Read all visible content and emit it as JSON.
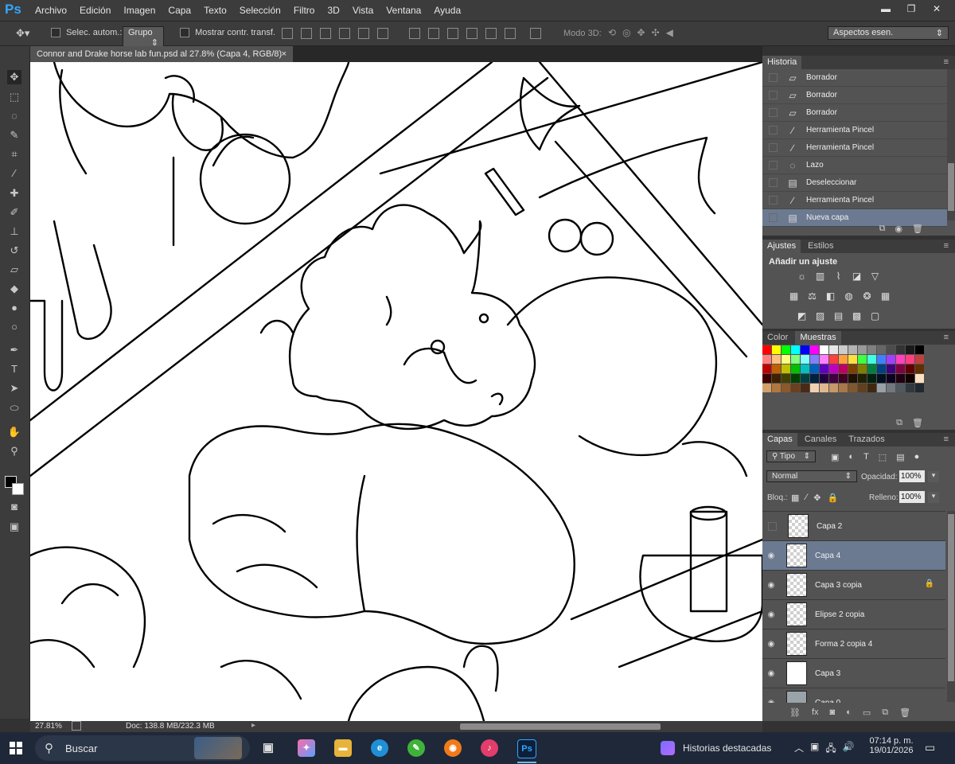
{
  "app": {
    "logo": "Ps"
  },
  "menu": [
    "Archivo",
    "Edición",
    "Imagen",
    "Capa",
    "Texto",
    "Selección",
    "Filtro",
    "3D",
    "Vista",
    "Ventana",
    "Ayuda"
  ],
  "window_controls": {
    "minimize": "▬",
    "restore": "❐",
    "close": "✕"
  },
  "options_bar": {
    "auto_select_label": "Selec. autom.:",
    "auto_select_value": "Grupo",
    "transform_label": "Mostrar contr. transf.",
    "mode3d_label": "Modo 3D:",
    "workspace": "Aspectos esen."
  },
  "document": {
    "tab_title": "Connor and Drake horse lab fun.psd al 27.8% (Capa 4, RGB/8)",
    "tab_close": "×"
  },
  "status": {
    "zoom": "27.81%",
    "doc_info": "Doc: 138.8 MB/232.3 MB"
  },
  "history": {
    "title": "Historia",
    "items": [
      {
        "label": "Borrador",
        "icon": "eraser-icon",
        "glyph": "▱"
      },
      {
        "label": "Borrador",
        "icon": "eraser-icon",
        "glyph": "▱"
      },
      {
        "label": "Borrador",
        "icon": "eraser-icon",
        "glyph": "▱"
      },
      {
        "label": "Herramienta Pincel",
        "icon": "brush-icon",
        "glyph": "∕"
      },
      {
        "label": "Herramienta Pincel",
        "icon": "brush-icon",
        "glyph": "∕"
      },
      {
        "label": "Lazo",
        "icon": "lasso-icon",
        "glyph": "◌"
      },
      {
        "label": "Deseleccionar",
        "icon": "document-icon",
        "glyph": "▤"
      },
      {
        "label": "Herramienta Pincel",
        "icon": "brush-icon",
        "glyph": "∕"
      },
      {
        "label": "Nueva capa",
        "icon": "document-icon",
        "glyph": "▤"
      }
    ]
  },
  "adjustments": {
    "tab1": "Ajustes",
    "tab2": "Estilos",
    "heading": "Añadir un ajuste"
  },
  "swatches": {
    "tab1": "Color",
    "tab2": "Muestras"
  },
  "layers": {
    "tab1": "Capas",
    "tab2": "Canales",
    "tab3": "Trazados",
    "filter": "Tipo",
    "blend": "Normal",
    "opacity_label": "Opacidad:",
    "opacity": "100%",
    "lock_label": "Bloq.:",
    "fill_label": "Relleno:",
    "fill": "100%",
    "items": [
      {
        "name": "Capa 2",
        "visible": false,
        "locked": false
      },
      {
        "name": "Capa 4",
        "visible": true,
        "locked": false
      },
      {
        "name": "Capa 3 copia",
        "visible": true,
        "locked": true
      },
      {
        "name": "Elipse 2 copia",
        "visible": true,
        "locked": false
      },
      {
        "name": "Forma 2 copia 4",
        "visible": true,
        "locked": false
      },
      {
        "name": "Capa 3",
        "visible": true,
        "locked": false
      },
      {
        "name": "Capa 0",
        "visible": true,
        "locked": false
      }
    ]
  },
  "taskbar": {
    "search_placeholder": "Buscar",
    "news": "Historias destacadas",
    "time": "07:14 p. m.",
    "date": "19/01/2026"
  }
}
